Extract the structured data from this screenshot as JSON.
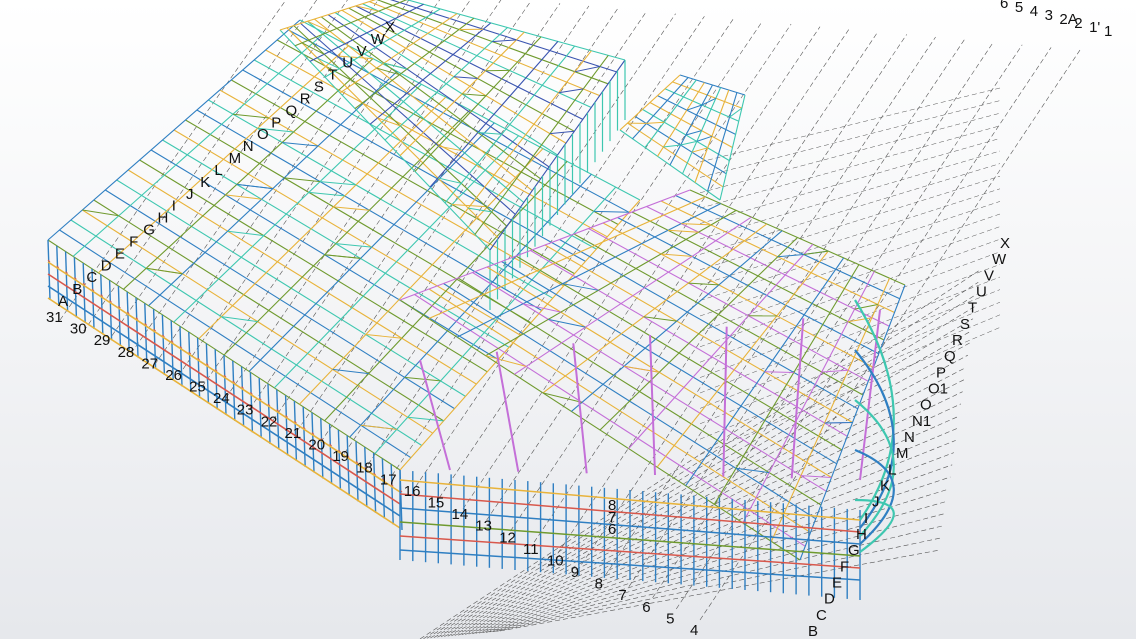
{
  "view": {
    "title": "",
    "background_top": "#ffffff",
    "background_bottom": "#e6e8ec"
  },
  "model": {
    "member_colors": {
      "outer_column": "#2f7fc2",
      "perimeter_beam": "#e8b33a",
      "secondary_beam": "#3ec7b0",
      "purlin": "#6f9a2e",
      "brace": "#c46fd8",
      "tie": "#d8584c",
      "frame": "#3a54b0"
    }
  },
  "grid_labels": {
    "numbers_front": [
      "31",
      "30",
      "29",
      "28",
      "27",
      "26",
      "25",
      "24",
      "23",
      "22",
      "21",
      "20",
      "19",
      "18",
      "17",
      "16",
      "15",
      "14",
      "13",
      "12",
      "11",
      "10",
      "9",
      "8",
      "7",
      "6",
      "5",
      "4"
    ],
    "letters_left": [
      "A",
      "B",
      "C",
      "D",
      "E",
      "F",
      "G",
      "H",
      "I",
      "J",
      "K",
      "L",
      "M",
      "N",
      "O",
      "P",
      "Q",
      "R",
      "S",
      "T",
      "U",
      "V",
      "W",
      "X"
    ],
    "letters_right": [
      "X",
      "W",
      "V",
      "U",
      "T",
      "S",
      "R",
      "Q",
      "P",
      "O1",
      "O",
      "N1",
      "N",
      "M",
      "L",
      "K",
      "J",
      "I",
      "H",
      "G",
      "F",
      "E",
      "D",
      "C",
      "B"
    ],
    "top_right": [
      "6",
      "5",
      "4",
      "3",
      "2A",
      "2",
      "1'",
      "1"
    ],
    "mid": [
      "8",
      "7",
      "6"
    ]
  }
}
